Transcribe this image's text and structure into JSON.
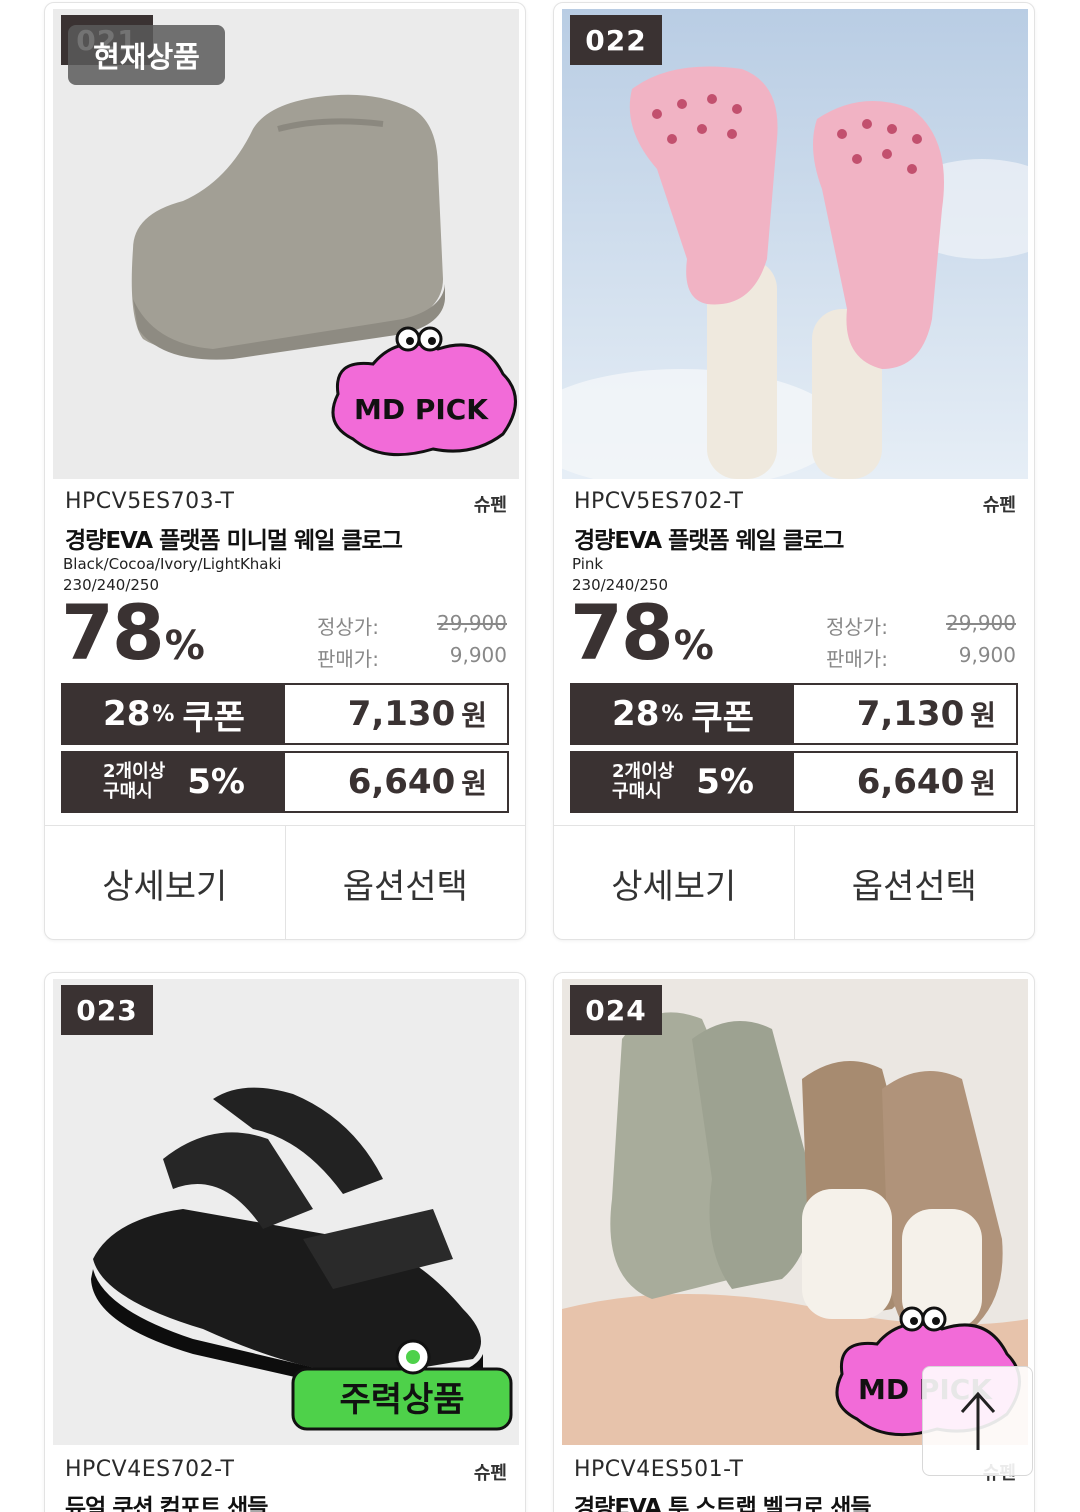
{
  "current_tag": "현재상품",
  "buttons": {
    "detail": "상세보기",
    "option": "옵션선택"
  },
  "labels": {
    "regular_price": "정상가:",
    "sale_price": "판매가:",
    "coupon_label": "쿠폰",
    "multi_line1": "2개이상",
    "multi_line2": "구매시",
    "won": "원",
    "percent": "%"
  },
  "products": [
    {
      "number": "021",
      "code": "HPCV5ES703-T",
      "brand": "슈펜",
      "name": "경량EVA 플랫폼 미니멀 웨일 클로그",
      "colors": "Black/Cocoa/Ivory/LightKhaki",
      "sizes": "230/240/250",
      "discount": "78",
      "regular_price": "29,900",
      "sale_price": "9,900",
      "coupon_pct": "28",
      "coupon_price": "7,130",
      "multi_pct": "5%",
      "multi_price": "6,640",
      "sticker": "MD PICK"
    },
    {
      "number": "022",
      "code": "HPCV5ES702-T",
      "brand": "슈펜",
      "name": "경량EVA 플랫폼 웨일 클로그",
      "colors": "Pink",
      "sizes": "230/240/250",
      "discount": "78",
      "regular_price": "29,900",
      "sale_price": "9,900",
      "coupon_pct": "28",
      "coupon_price": "7,130",
      "multi_pct": "5%",
      "multi_price": "6,640"
    },
    {
      "number": "023",
      "code": "HPCV4ES702-T",
      "brand": "슈펜",
      "name": "듀얼 쿠션 컴포트 샌들",
      "sticker": "주력상품"
    },
    {
      "number": "024",
      "code": "HPCV4ES501-T",
      "brand": "슈펜",
      "name": "경량EVA 투 스트랩 벨크로 샌들",
      "sticker": "MD PICK"
    }
  ],
  "icons": {
    "scroll_top": "arrow-up-icon"
  },
  "colors": {
    "dark": "#3a3232",
    "sticker_pink": "#f26bd8",
    "sticker_green": "#4ed14a"
  }
}
